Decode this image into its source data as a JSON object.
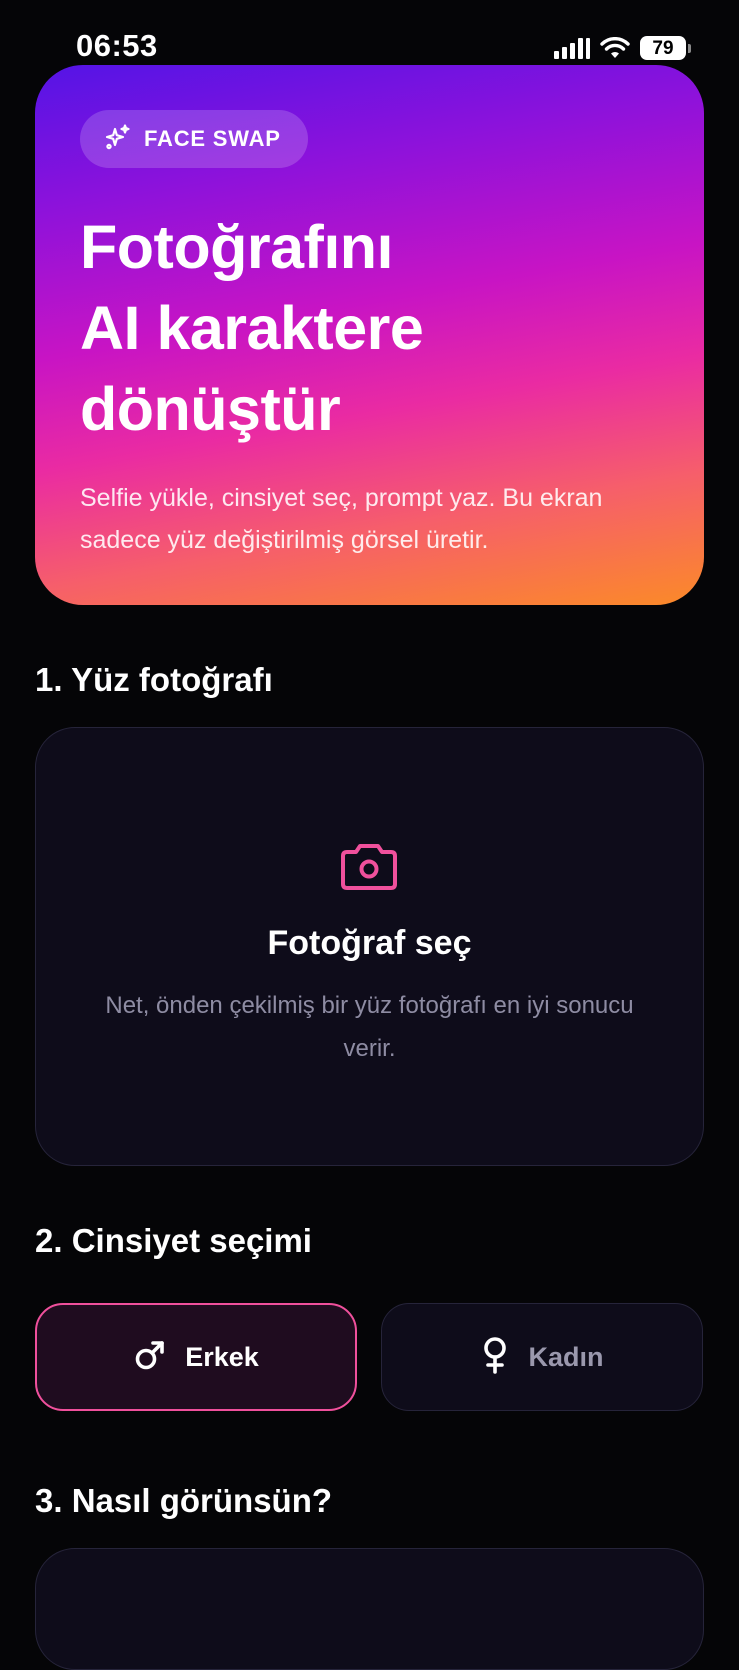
{
  "status": {
    "time": "06:53",
    "battery": "79"
  },
  "hero": {
    "badge": "FACE SWAP",
    "title_lines": [
      "Fotoğrafını",
      "AI karaktere",
      "dönüştür"
    ],
    "description": "Selfie yükle, cinsiyet seç, prompt yaz. Bu ekran sadece yüz değiştirilmiş görsel üretir."
  },
  "sections": {
    "face_photo": "1. Yüz fotoğrafı",
    "gender": "2. Cinsiyet seçimi",
    "appearance": "3. Nasıl görünsün?"
  },
  "upload": {
    "title": "Fotoğraf seç",
    "description": "Net, önden çekilmiş bir yüz fotoğrafı en iyi sonucu verir."
  },
  "gender": {
    "options": [
      "Erkek",
      "Kadın"
    ],
    "selected": "Erkek"
  },
  "colors": {
    "accent": "#f0509c",
    "hero_gradient": [
      "#5414e6",
      "#c814c4",
      "#fb8a28"
    ],
    "background": "#050507",
    "card": "#0e0c1a"
  },
  "icons": [
    "sparkles-icon",
    "camera-icon",
    "male-icon",
    "female-icon"
  ]
}
